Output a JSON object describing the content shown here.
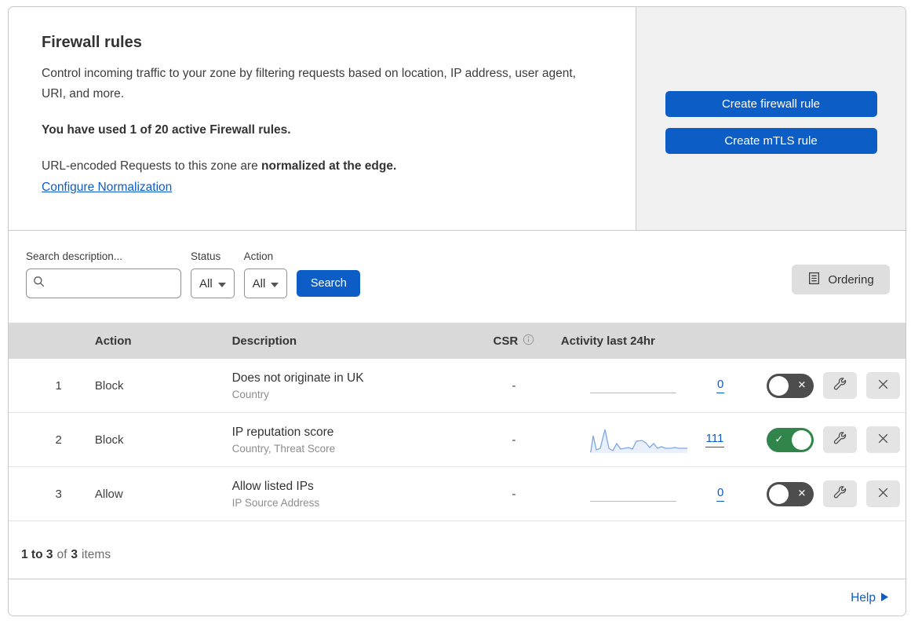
{
  "colors": {
    "accent_blue": "#0d5dc6",
    "toggle_on_green": "#2f854a",
    "toggle_off_gray": "#4d4d4d",
    "table_header_gray": "#d9d9d9",
    "panel_gray": "#f1f1f1"
  },
  "header": {
    "title": "Firewall rules",
    "description": "Control incoming traffic to your zone by filtering requests based on location, IP address, user agent, URI, and more.",
    "usage_note": "You have used 1 of 20 active Firewall rules.",
    "normalization_text": "URL-encoded Requests to this zone are ",
    "normalization_bold": "normalized at the edge.",
    "normalization_link": "Configure Normalization",
    "create_firewall_button": "Create firewall rule",
    "create_mtls_button": "Create mTLS rule"
  },
  "filters": {
    "search_label": "Search description...",
    "status_label": "Status",
    "status_value": "All",
    "action_label": "Action",
    "action_value": "All",
    "search_button": "Search",
    "ordering_button": "Ordering"
  },
  "table": {
    "headers": {
      "action": "Action",
      "description": "Description",
      "csr": "CSR",
      "activity": "Activity last 24hr"
    },
    "rows": [
      {
        "num": "1",
        "action": "Block",
        "description": "Does not originate in UK",
        "criteria": "Country",
        "csr": "-",
        "activity_count": "0",
        "enabled": false
      },
      {
        "num": "2",
        "action": "Block",
        "description": "IP reputation score",
        "criteria": "Country, Threat Score",
        "csr": "-",
        "activity_count": "111",
        "enabled": true,
        "sparkline_relative": [
          2,
          20,
          4,
          6,
          30,
          5,
          3,
          11,
          5,
          6,
          7,
          5,
          15,
          16,
          13,
          7,
          12,
          6,
          8,
          6,
          6,
          7,
          6,
          6
        ]
      },
      {
        "num": "3",
        "action": "Allow",
        "description": "Allow listed IPs",
        "criteria": "IP Source Address",
        "csr": "-",
        "activity_count": "0",
        "enabled": false
      }
    ]
  },
  "footer": {
    "range": "1 to 3",
    "of_text": "of",
    "total": "3",
    "items_text": "items",
    "help_link": "Help"
  }
}
